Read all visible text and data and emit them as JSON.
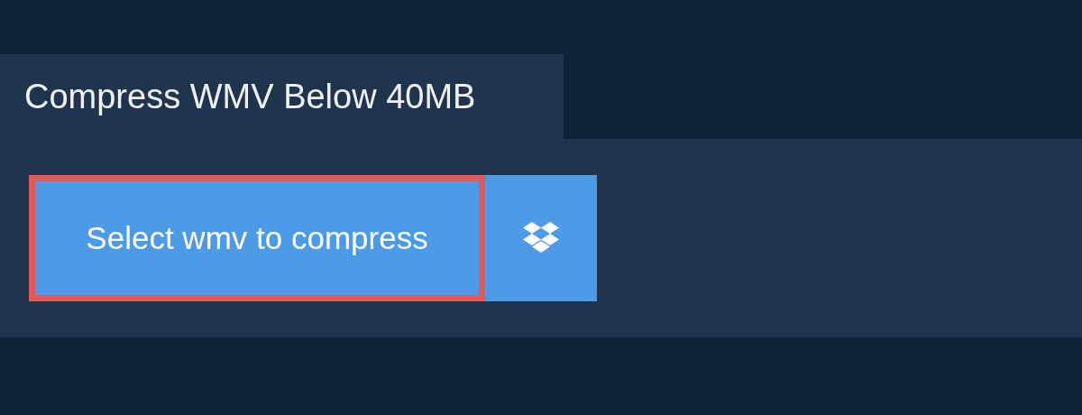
{
  "tab": {
    "title": "Compress WMV Below 40MB"
  },
  "upload": {
    "label": "Select wmv to compress",
    "highlighted": true
  }
}
